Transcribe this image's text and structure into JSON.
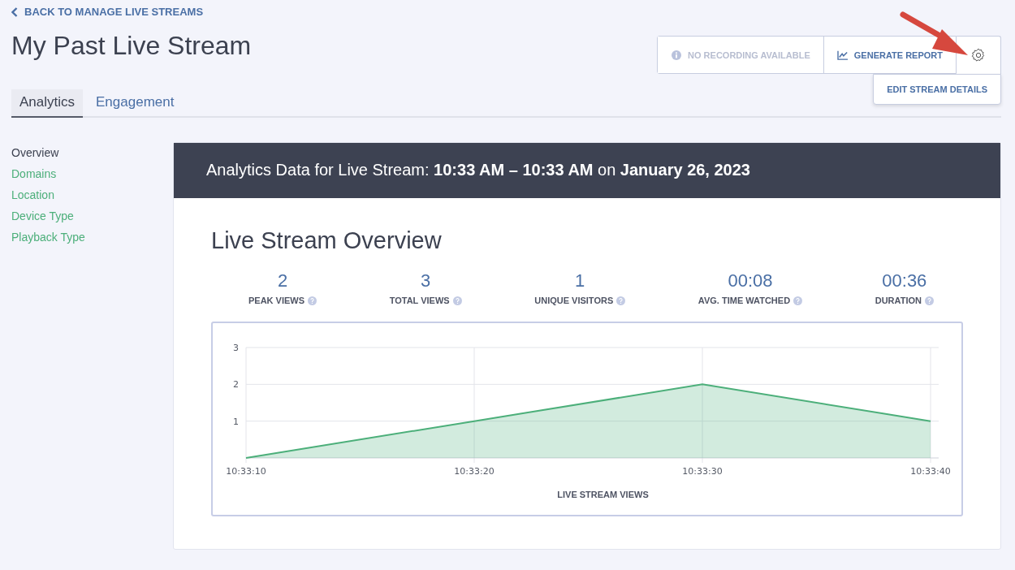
{
  "back_link": "BACK TO MANAGE LIVE STREAMS",
  "page_title": "My Past Live Stream",
  "actions": [
    {
      "label": "NO RECORDING AVAILABLE",
      "kind": "info",
      "disabled": true
    },
    {
      "label": "GENERATE REPORT",
      "kind": "report",
      "disabled": false
    }
  ],
  "settings_menu": {
    "expanded": true,
    "items": [
      "EDIT STREAM DETAILS"
    ]
  },
  "tabs": [
    {
      "label": "Analytics",
      "selected": true
    },
    {
      "label": "Engagement",
      "selected": false
    }
  ],
  "sidebar": {
    "items": [
      {
        "label": "Overview",
        "selected": true
      },
      {
        "label": "Domains",
        "selected": false
      },
      {
        "label": "Location",
        "selected": false
      },
      {
        "label": "Device Type",
        "selected": false
      },
      {
        "label": "Playback Type",
        "selected": false
      }
    ]
  },
  "panel": {
    "header": "Analytics Data for Live Stream: **10:33 AM – 10:33 AM** on **January 26, 2023**",
    "title": "Live Stream Overview",
    "stats": [
      {
        "value": "2",
        "label": "PEAK VIEWS"
      },
      {
        "value": "3",
        "label": "TOTAL VIEWS"
      },
      {
        "value": "1",
        "label": "UNIQUE VISITORS"
      },
      {
        "value": "00:08",
        "label": "AVG. TIME WATCHED"
      },
      {
        "value": "00:36",
        "label": "DURATION"
      }
    ],
    "chart_data": {
      "type": "area",
      "xlabel": "LIVE STREAM VIEWS",
      "categories": [
        "10:33:10",
        "10:33:20",
        "10:33:30",
        "10:33:40"
      ],
      "series": [
        {
          "color": "#4caf7a",
          "values": [
            0,
            1,
            2,
            1
          ]
        }
      ],
      "ylim": [
        0,
        3
      ],
      "yticks": [
        1,
        2,
        3
      ],
      "grid": true
    }
  }
}
